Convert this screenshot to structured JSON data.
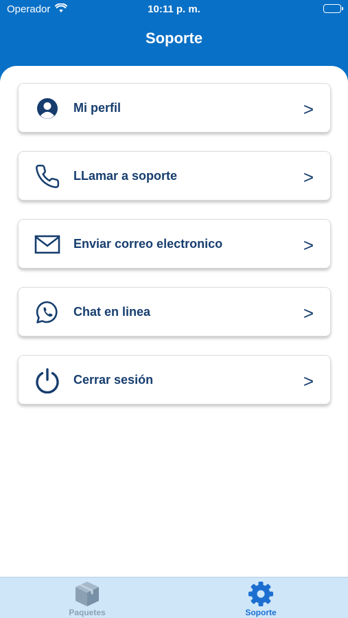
{
  "status_bar": {
    "carrier": "Operador",
    "time": "10:11 p. m."
  },
  "header": {
    "title": "Soporte"
  },
  "menu": {
    "items": [
      {
        "label": "Mi perfil",
        "chevron": ">",
        "icon": "user-icon"
      },
      {
        "label": "LLamar a soporte",
        "chevron": ">",
        "icon": "phone-icon"
      },
      {
        "label": "Enviar correo electronico",
        "chevron": ">",
        "icon": "mail-icon"
      },
      {
        "label": "Chat en linea",
        "chevron": ">",
        "icon": "whatsapp-icon"
      },
      {
        "label": "Cerrar sesión",
        "chevron": ">",
        "icon": "power-icon"
      }
    ]
  },
  "tabs": [
    {
      "label": "Paquetes",
      "icon": "package-icon",
      "active": false
    },
    {
      "label": "Soporte",
      "icon": "gear-icon",
      "active": true
    }
  ],
  "colors": {
    "brand": "#0870c6",
    "text": "#163d6e",
    "tab_bar": "#cfe6f9",
    "active_tab": "#1c6fd1",
    "inactive_tab": "#8ba1b3"
  }
}
